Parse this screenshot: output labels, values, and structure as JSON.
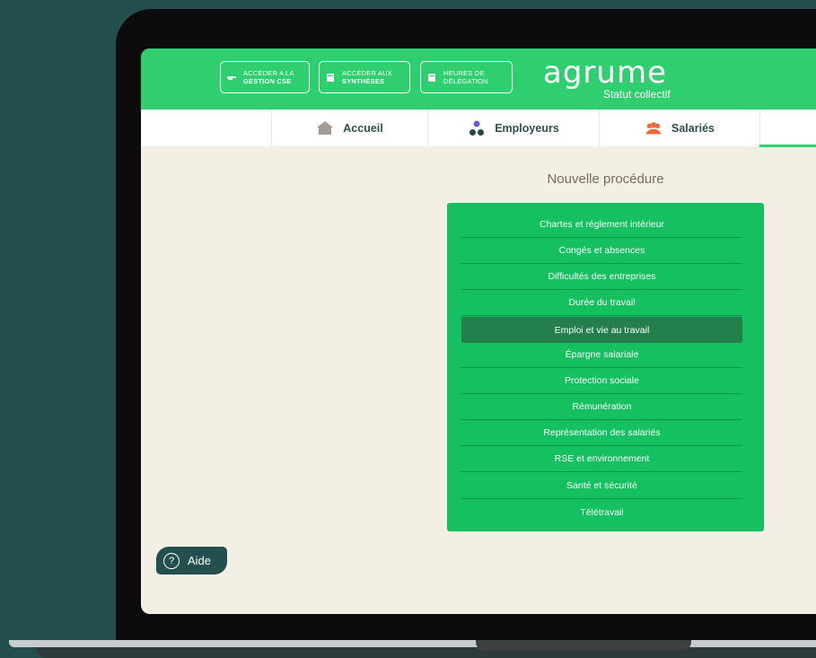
{
  "header": {
    "buttons": [
      {
        "line1": "ACCÉDER A LA",
        "line2": "GESTION CSE",
        "icon": "pointing-hand-icon"
      },
      {
        "line1": "ACCÉDER AUX",
        "line2": "SYNTHÈSES",
        "icon": "document-icon"
      },
      {
        "line1": "HEURES DE",
        "line2": "DÉLÉGATION",
        "icon": "document-icon"
      }
    ],
    "logo": {
      "brand": "agrume",
      "subtitle": "Statut collectif"
    }
  },
  "nav": {
    "tabs": [
      {
        "label": "Accueil",
        "icon": "home-icon"
      },
      {
        "label": "Employeurs",
        "icon": "employers-icon"
      },
      {
        "label": "Salariés",
        "icon": "employees-icon"
      }
    ]
  },
  "main": {
    "title": "Nouvelle procédure",
    "items": [
      "Chartes et réglement intérieur",
      "Congés et absences",
      "Difficultés des entreprises",
      "Durée du travail",
      "Emploi et vie au travail",
      "Épargne salariale",
      "Protection sociale",
      "Rémunération",
      "Représentation des salariés",
      "RSE et environnement",
      "Santé et sécurité",
      "Télétravail"
    ],
    "selected_index": 4
  },
  "help": {
    "label": "Aide",
    "icon": "question-icon"
  },
  "colors": {
    "brand_green": "#2fcf70",
    "menu_green": "#14c060",
    "selected": "#237f4b",
    "dark_teal": "#224e4d"
  }
}
